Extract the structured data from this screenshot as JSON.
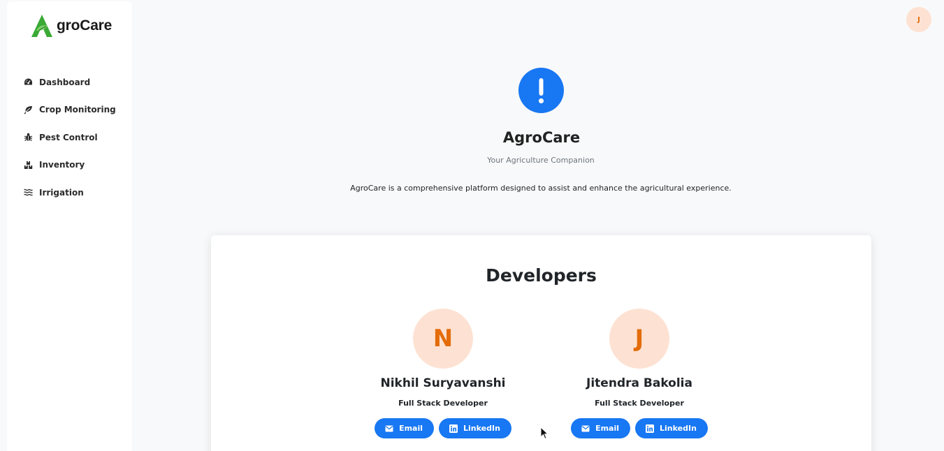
{
  "brand": {
    "name": "groCare",
    "logo_letter": "A",
    "accent": "#3aa935"
  },
  "sidebar": {
    "items": [
      {
        "label": "Dashboard",
        "icon": "gauge-icon"
      },
      {
        "label": "Crop Monitoring",
        "icon": "leaf-icon"
      },
      {
        "label": "Pest Control",
        "icon": "bug-icon"
      },
      {
        "label": "Inventory",
        "icon": "boxes-icon"
      },
      {
        "label": "Irrigation",
        "icon": "water-icon"
      }
    ]
  },
  "header": {
    "avatar_initial": "J"
  },
  "hero": {
    "icon": "exclamation-icon",
    "title": "AgroCare",
    "subtitle": "Your Agriculture Companion",
    "description": "AgroCare is a comprehensive platform designed to assist and enhance the agricultural experience."
  },
  "developers": {
    "heading": "Developers",
    "list": [
      {
        "initial": "N",
        "name": "Nikhil Suryavanshi",
        "role": "Full Stack Developer",
        "email_label": "Email",
        "linkedin_label": "LinkedIn"
      },
      {
        "initial": "J",
        "name": "Jitendra Bakolia",
        "role": "Full Stack Developer",
        "email_label": "Email",
        "linkedin_label": "LinkedIn"
      }
    ]
  },
  "colors": {
    "primary": "#1877f2",
    "avatar_bg": "#fde2d3",
    "avatar_text": "#e46c0a",
    "background": "#f8f9fa"
  }
}
